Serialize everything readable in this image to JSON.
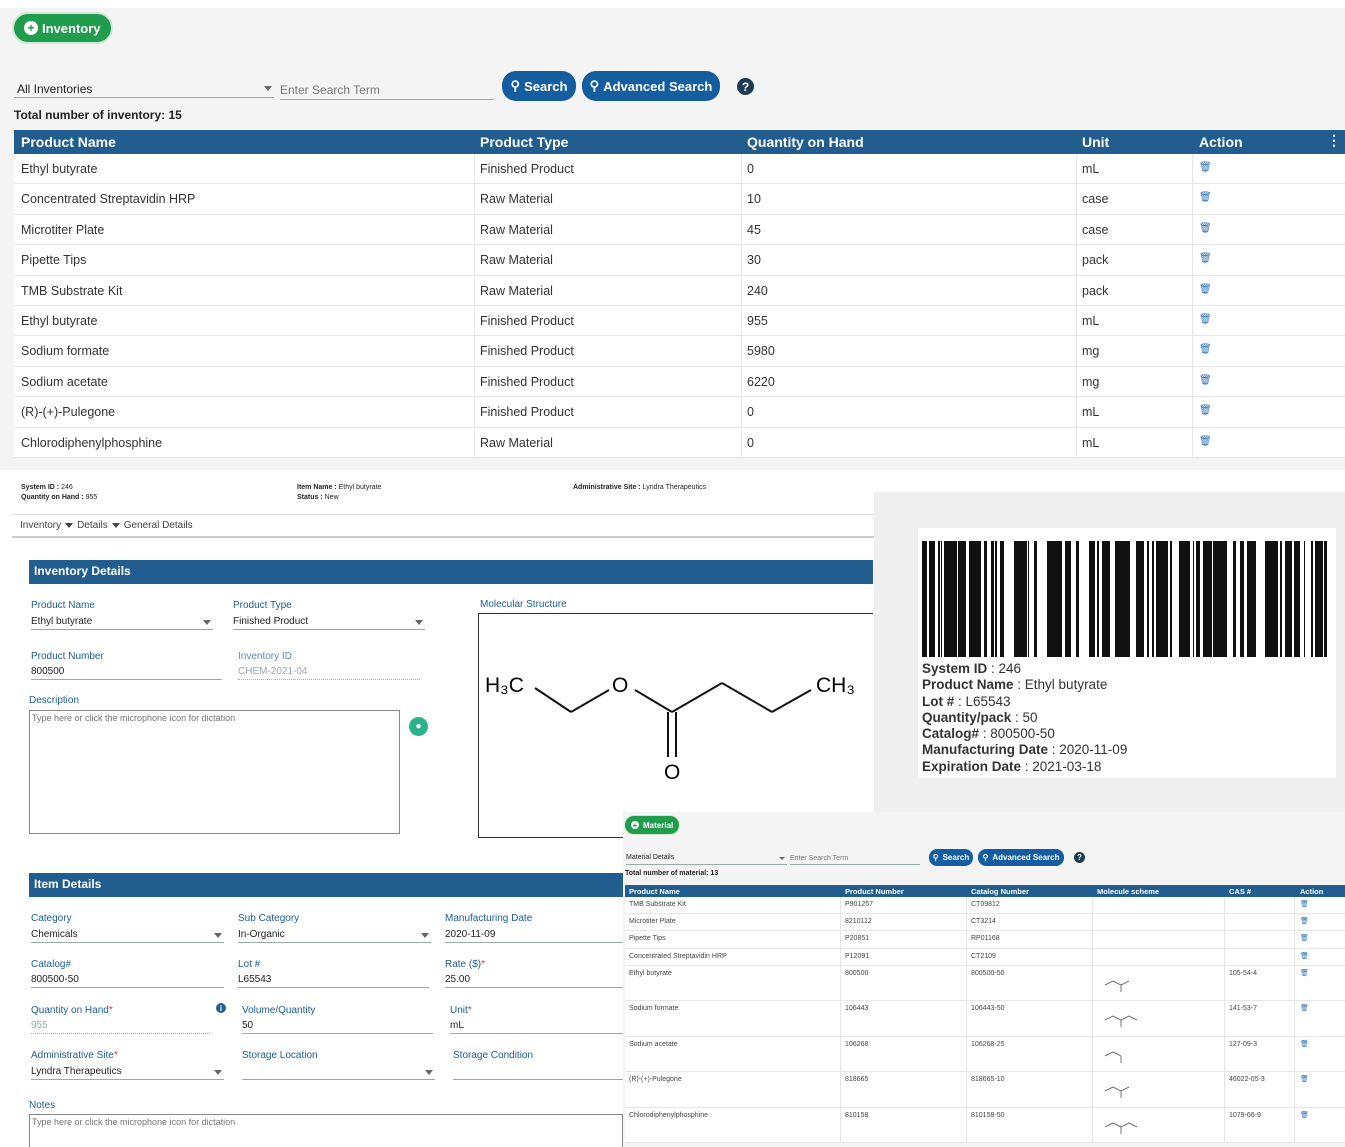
{
  "top": {
    "inventory_button": "Inventory",
    "filter_value": "All Inventories",
    "search_placeholder": "Enter Search Term",
    "search_label": "Search",
    "advanced_label": "Advanced Search",
    "total_text": "Total number of inventory: 15",
    "columns": [
      "Product Name",
      "Product Type",
      "Quantity on Hand",
      "Unit",
      "Action"
    ],
    "rows": [
      [
        "Ethyl butyrate",
        "Finished Product",
        "0",
        "mL"
      ],
      [
        "Concentrated Streptavidin HRP",
        "Raw Material",
        "10",
        "case"
      ],
      [
        "Microtiter Plate",
        "Raw Material",
        "45",
        "case"
      ],
      [
        "Pipette Tips",
        "Raw Material",
        "30",
        "pack"
      ],
      [
        "TMB Substrate Kit",
        "Raw Material",
        "240",
        "pack"
      ],
      [
        "Ethyl butyrate",
        "Finished Product",
        "955",
        "mL"
      ],
      [
        "Sodium formate",
        "Finished Product",
        "5980",
        "mg"
      ],
      [
        "Sodium acetate",
        "Finished Product",
        "6220",
        "mg"
      ],
      [
        "(R)-(+)-Pulegone",
        "Finished Product",
        "0",
        "mL"
      ],
      [
        "Chlorodiphenylphosphine",
        "Raw Material",
        "0",
        "mL"
      ]
    ]
  },
  "summary": {
    "system_id_label": "System ID :",
    "system_id": "246",
    "qoh_label": "Quantity on Hand :",
    "qoh": "955",
    "item_name_label": "Item Name :",
    "item_name": "Ethyl butyrate",
    "status_label": "Status :",
    "status": "New",
    "admin_site_label": "Administrative Site :",
    "admin_site": "Lyndra Therapeutics"
  },
  "breadcrumb": [
    "Inventory",
    "Details",
    "General Details"
  ],
  "inventory_details": {
    "header": "Inventory Details",
    "product_name_label": "Product Name",
    "product_name": "Ethyl butyrate",
    "product_type_label": "Product Type",
    "product_type": "Finished Product",
    "product_number_label": "Product Number",
    "product_number": "800500",
    "inventory_id_label": "Inventory ID",
    "inventory_id": "CHEM-2021-04",
    "description_label": "Description",
    "description_placeholder": "Type here or click the microphone icon for dictation",
    "molecular_label": "Molecular Structure",
    "mol": {
      "h3c": "H₃C",
      "o1": "O",
      "o2": "O",
      "ch3": "CH₃"
    }
  },
  "item_details": {
    "header": "Item Details",
    "category_label": "Category",
    "category": "Chemicals",
    "sub_category_label": "Sub Category",
    "sub_category": "In-Organic",
    "mfg_date_label": "Manufacturing Date",
    "mfg_date": "2020-11-09",
    "catalog_label": "Catalog#",
    "catalog": "800500-50",
    "lot_label": "Lot #",
    "lot": "L65543",
    "rate_label": "Rate ($)",
    "rate": "25.00",
    "qoh_label": "Quantity on Hand",
    "qoh": "955",
    "vol_label": "Volume/Quantity",
    "vol": "50",
    "unit_label": "Unit",
    "unit": "mL",
    "admin_site_label": "Administrative Site",
    "admin_site": "Lyndra Therapeutics",
    "storage_location_label": "Storage Location",
    "storage_condition_label": "Storage Condition",
    "notes_label": "Notes",
    "notes_placeholder": "Type here or click the microphone icon for dictation",
    "required_mark": "*"
  },
  "label": {
    "lines": [
      [
        "System ID",
        " : 246"
      ],
      [
        "Product Name",
        " : Ethyl butyrate"
      ],
      [
        "Lot #",
        " : L65543"
      ],
      [
        "Quantity/pack",
        " : 50"
      ],
      [
        "Catalog#",
        " : 800500-50"
      ],
      [
        "Manufacturing Date",
        " : 2020-11-09"
      ],
      [
        "Expiration Date",
        " : 2021-03-18"
      ]
    ]
  },
  "material": {
    "button": "Material",
    "filter_value": "Material Details",
    "search_placeholder": "Enter Search Term",
    "search_label": "Search",
    "advanced_label": "Advanced Search",
    "total_text": "Total number of material: 13",
    "columns": [
      "Product Name",
      "Product Number",
      "Catalog Number",
      "Molecule scheme",
      "CAS #",
      "Action"
    ],
    "rows": [
      [
        "TMB Substrate Kit",
        "P901257",
        "CT09812",
        "",
        ""
      ],
      [
        "Microtiter Plate",
        "8210112",
        "CT3214",
        "",
        ""
      ],
      [
        "Pipette Tips",
        "P20851",
        "RP01168",
        "",
        ""
      ],
      [
        "Concentrated Streptavidin HRP",
        "P12091",
        "CT2109",
        "",
        ""
      ],
      [
        "Ethyl butyrate",
        "800500",
        "800500-50",
        "mol",
        "105-54-4"
      ],
      [
        "Sodium formate",
        "106443",
        "106443-50",
        "mol",
        "141-53-7"
      ],
      [
        "Sodium acetate",
        "106268",
        "106268-25",
        "mol",
        "127-09-3"
      ],
      [
        "(R)-(+)-Pulegone",
        "818665",
        "818665-10",
        "mol",
        "46022-05-3"
      ],
      [
        "Chlorodiphenylphosphine",
        "810158",
        "810158-50",
        "mol",
        "1079-66-9"
      ]
    ]
  }
}
